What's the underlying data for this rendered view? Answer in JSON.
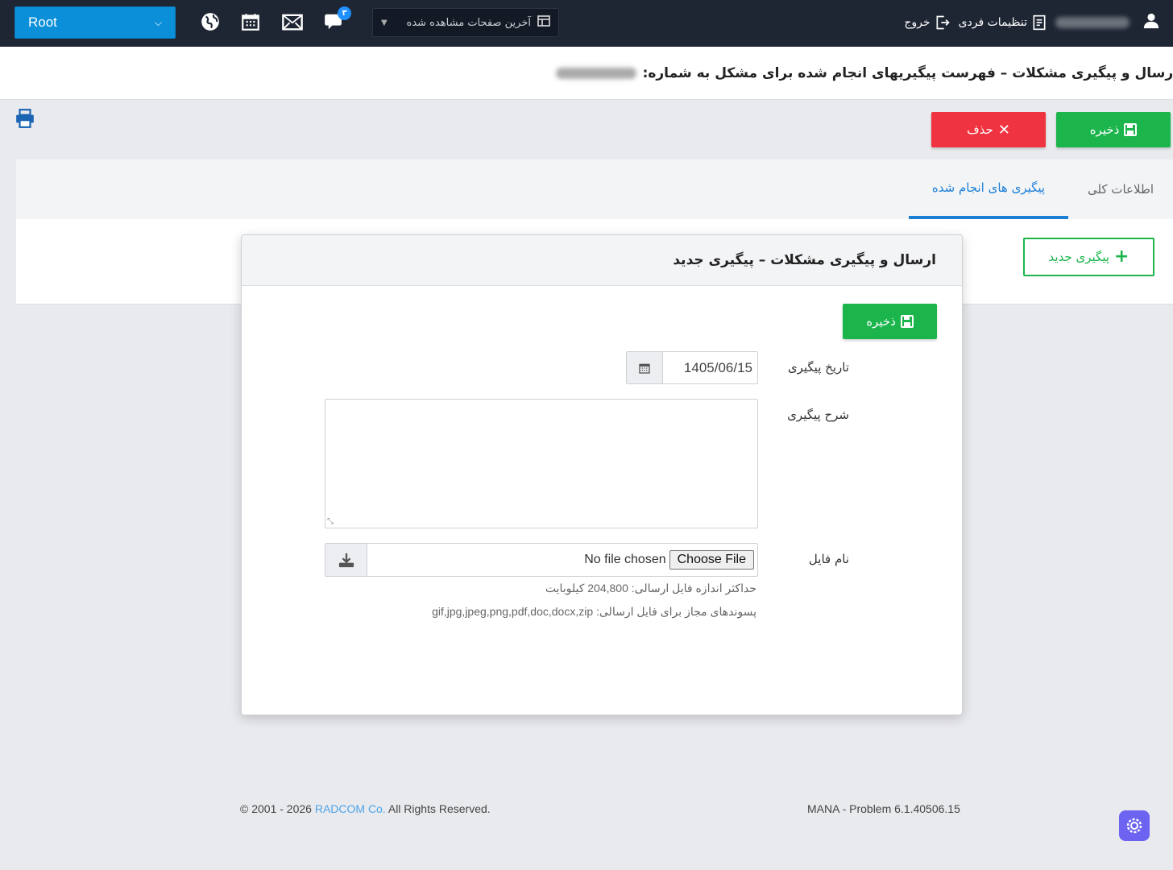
{
  "navbar": {
    "root_select": "Root",
    "badge_count": "۳",
    "recent_pages": "آخرین صفحات مشاهده شده",
    "settings": "تنظیمات فردی",
    "logout": "خروج",
    "icons": [
      "globe-icon",
      "calendar-icon",
      "mail-icon",
      "chat-icon",
      "table-icon",
      "user-icon"
    ]
  },
  "page": {
    "title": "ارسال و پیگیری مشکلات – فهرست پیگیریهای انجام شده برای مشکل به شماره:"
  },
  "toolbar": {
    "save_label": "ذخیره",
    "delete_label": "حذف"
  },
  "tabs": [
    {
      "label": "اطلاعات کلی"
    },
    {
      "label": "پیگیری های انجام شده"
    }
  ],
  "new_followup_label": "پیگیری جدید",
  "modal": {
    "title": "ارسال و پیگیری مشکلات – پیگیری جدید",
    "save_label": "ذخیره",
    "date_label": "تاریخ پیگیری",
    "date_value": "1405/06/15",
    "desc_label": "شرح پیگیری",
    "file_label": "نام فایل",
    "file_button": "Choose File",
    "file_status": "No file chosen",
    "max_size_hint": "حداکثر اندازه فایل ارسالی: 204,800 کیلوبایت",
    "allowed_ext_hint": "پسوندهای مجاز برای فایل ارسالی: gif,jpg,jpeg,png,pdf,doc,docx,zip"
  },
  "footer": {
    "copyright_prefix": "© 2001 - 2026 ",
    "company": "RADCOM Co.",
    "copyright_suffix": " All Rights Reserved.",
    "version": "MANA - Problem 6.1.40506.15"
  },
  "colors": {
    "navbar": "#1e2533",
    "accent_blue": "#1b7fd6",
    "success": "#1bb54c",
    "danger": "#ef3340"
  }
}
